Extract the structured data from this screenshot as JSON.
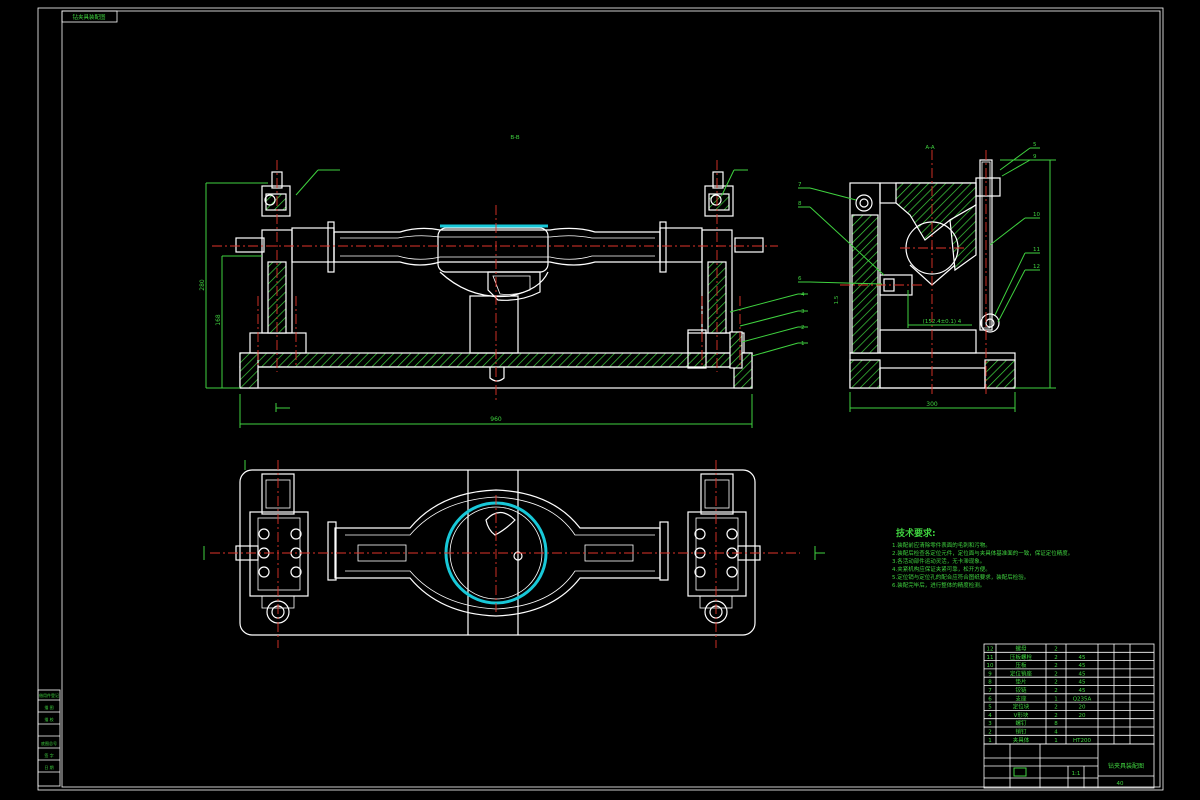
{
  "drawing": {
    "title": "",
    "views": {
      "front_label": "B-B",
      "side_label": "A-A"
    },
    "callouts": [
      "1",
      "2",
      "3",
      "4",
      "5",
      "6",
      "7",
      "8",
      "9",
      "10",
      "11",
      "12"
    ],
    "tech_requirements": {
      "heading": "技术要求:",
      "lines": [
        "1.装配前应清除零件表面的毛刺和污物。",
        "2.装配后检查各定位元件，定位面与夹具体基准面的一致，保证定位精度。",
        "3.各活动部件运动灵活，无卡滞现象。",
        "4.夹紧机构应保证夹紧可靠，松开方便。",
        "5.定位销与定位孔的配合应符合图纸要求，装配后检验。",
        "6.装配完毕后，进行整体的精度检测。"
      ]
    },
    "parts_list": [
      {
        "no": "12",
        "name": "螺母",
        "qty": "2",
        "mat": ""
      },
      {
        "no": "11",
        "name": "压板螺栓",
        "qty": "2",
        "mat": "45"
      },
      {
        "no": "10",
        "name": "压板",
        "qty": "2",
        "mat": "45"
      },
      {
        "no": "9",
        "name": "定位销座",
        "qty": "2",
        "mat": "45"
      },
      {
        "no": "8",
        "name": "垫片",
        "qty": "2",
        "mat": "45"
      },
      {
        "no": "7",
        "name": "铰链",
        "qty": "2",
        "mat": "45"
      },
      {
        "no": "6",
        "name": "支座",
        "qty": "1",
        "mat": "Q235A"
      },
      {
        "no": "5",
        "name": "定位块",
        "qty": "2",
        "mat": "20"
      },
      {
        "no": "4",
        "name": "V形块",
        "qty": "2",
        "mat": "20"
      },
      {
        "no": "3",
        "name": "螺钉",
        "qty": "8",
        "mat": ""
      },
      {
        "no": "2",
        "name": "销钉",
        "qty": "4",
        "mat": ""
      },
      {
        "no": "1",
        "name": "夹具体",
        "qty": "1",
        "mat": "HT200"
      }
    ],
    "title_block": {
      "name": "钻夹具装配图",
      "scale": "1:1",
      "sheet": "40"
    },
    "corner_label": "钻夹具装配图",
    "left_strip": [
      "借用件登记",
      "描 图",
      "描 校",
      "底图总号",
      "签 字",
      "日 期"
    ]
  },
  "colors": {
    "background": "#000000",
    "outline": "#ffffff",
    "dimension": "#3fd23f",
    "centerline": "#e0342a",
    "highlight": "#18c8d8"
  }
}
